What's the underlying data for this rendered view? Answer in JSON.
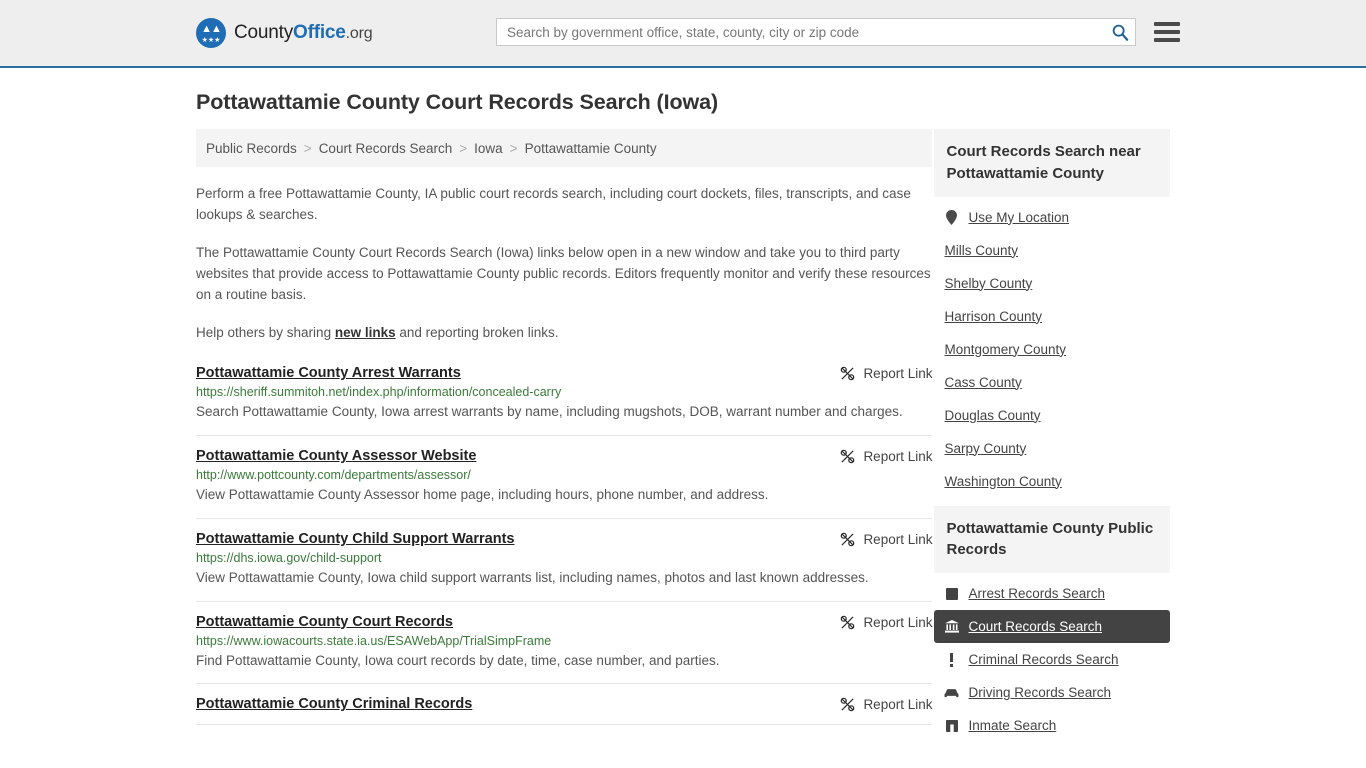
{
  "header": {
    "logo": {
      "part1": "County",
      "part2": "Office",
      "part3": ".org",
      "icon": "eagle-seal-icon"
    },
    "search": {
      "placeholder": "Search by government office, state, county, city or zip code",
      "value": "",
      "icon": "search-icon"
    },
    "menu_icon": "hamburger-menu-icon",
    "accent_color": "#2b6ca3"
  },
  "page": {
    "title": "Pottawattamie County Court Records Search (Iowa)"
  },
  "breadcrumb": {
    "items": [
      {
        "label": "Public Records"
      },
      {
        "label": "Court Records Search"
      },
      {
        "label": "Iowa"
      },
      {
        "label": "Pottawattamie County"
      }
    ],
    "separator": ">"
  },
  "intro": {
    "p1": "Perform a free Pottawattamie County, IA public court records search, including court dockets, files, transcripts, and case lookups & searches.",
    "p2": "The Pottawattamie County Court Records Search (Iowa) links below open in a new window and take you to third party websites that provide access to Pottawattamie County public records. Editors frequently monitor and verify these resources on a routine basis.",
    "p3_before": "Help others by sharing ",
    "p3_link": "new links",
    "p3_after": " and reporting broken links."
  },
  "results": {
    "report_label": "Report Link",
    "report_icon": "unlink-icon",
    "items": [
      {
        "title": "Pottawattamie County Arrest Warrants",
        "url": "https://sheriff.summitoh.net/index.php/information/concealed-carry",
        "description": "Search Pottawattamie County, Iowa arrest warrants by name, including mugshots, DOB, warrant number and charges."
      },
      {
        "title": "Pottawattamie County Assessor Website",
        "url": "http://www.pottcounty.com/departments/assessor/",
        "description": "View Pottawattamie County Assessor home page, including hours, phone number, and address."
      },
      {
        "title": "Pottawattamie County Child Support Warrants",
        "url": "https://dhs.iowa.gov/child-support",
        "description": "View Pottawattamie County, Iowa child support warrants list, including names, photos and last known addresses."
      },
      {
        "title": "Pottawattamie County Court Records",
        "url": "https://www.iowacourts.state.ia.us/ESAWebApp/TrialSimpFrame",
        "description": "Find Pottawattamie County, Iowa court records by date, time, case number, and parties."
      },
      {
        "title": "Pottawattamie County Criminal Records",
        "url": "",
        "description": ""
      }
    ]
  },
  "sidebar": {
    "nearby": {
      "heading": "Court Records Search near Pottawattamie County",
      "items": [
        {
          "label": "Use My Location",
          "icon": "map-pin-icon"
        },
        {
          "label": "Mills County",
          "icon": ""
        },
        {
          "label": "Shelby County",
          "icon": ""
        },
        {
          "label": "Harrison County",
          "icon": ""
        },
        {
          "label": "Montgomery County",
          "icon": ""
        },
        {
          "label": "Cass County",
          "icon": ""
        },
        {
          "label": "Douglas County",
          "icon": ""
        },
        {
          "label": "Sarpy County",
          "icon": ""
        },
        {
          "label": "Washington County",
          "icon": ""
        }
      ]
    },
    "public_records": {
      "heading": "Pottawattamie County Public Records",
      "active_label": "Court Records Search",
      "items": [
        {
          "label": "Arrest Records Search",
          "icon": "square-badge-icon",
          "active": false
        },
        {
          "label": "Court Records Search",
          "icon": "courthouse-icon",
          "active": true
        },
        {
          "label": "Criminal Records Search",
          "icon": "exclamation-icon",
          "active": false
        },
        {
          "label": "Driving Records Search",
          "icon": "car-icon",
          "active": false
        },
        {
          "label": "Inmate Search",
          "icon": "building-icon",
          "active": false
        }
      ]
    },
    "active_bg_color": "#434343"
  }
}
